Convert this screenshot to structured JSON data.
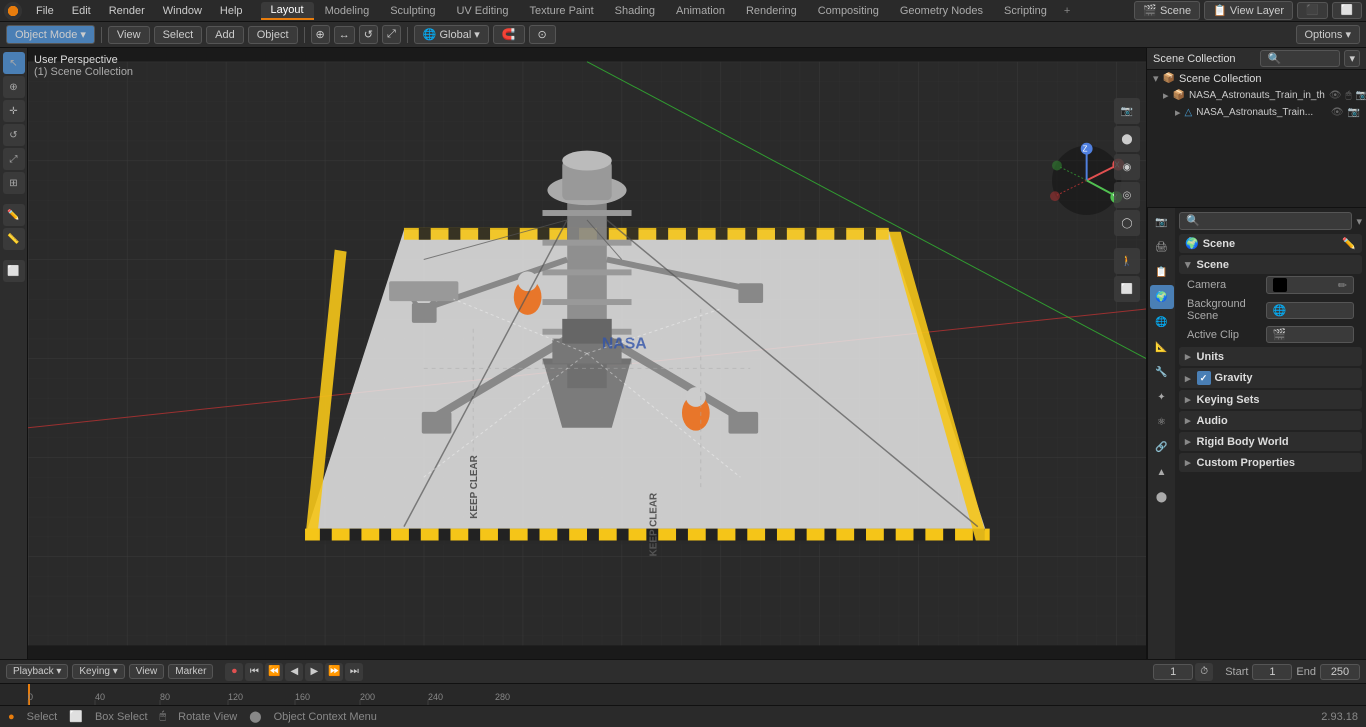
{
  "app": {
    "title": "Blender",
    "version": "2.93.18"
  },
  "top_menu": {
    "items": [
      "File",
      "Edit",
      "Render",
      "Window",
      "Help"
    ]
  },
  "workspace_tabs": {
    "tabs": [
      "Layout",
      "Modeling",
      "Sculpting",
      "UV Editing",
      "Texture Paint",
      "Shading",
      "Animation",
      "Rendering",
      "Compositing",
      "Geometry Nodes",
      "Scripting"
    ],
    "active": "Layout"
  },
  "second_bar": {
    "mode_label": "Object Mode",
    "view_label": "View",
    "select_label": "Select",
    "add_label": "Add",
    "object_label": "Object",
    "transform_label": "Global",
    "options_label": "Options ▾"
  },
  "viewport": {
    "info_line1": "User Perspective",
    "info_line2": "(1) Scene Collection"
  },
  "outliner": {
    "title": "Scene Collection",
    "items": [
      {
        "name": "NASA_Astronauts_Train_in_th",
        "type": "collection",
        "indent": 1,
        "expanded": true
      },
      {
        "name": "NASA_Astronauts_Train...",
        "type": "mesh",
        "indent": 2,
        "expanded": false
      }
    ]
  },
  "scene_name": "Scene",
  "view_layer_name": "View Layer",
  "properties": {
    "section_label": "Scene",
    "subsection_label": "Scene",
    "camera_label": "Camera",
    "camera_value": "",
    "background_scene_label": "Background Scene",
    "active_clip_label": "Active Clip",
    "units_label": "Units",
    "gravity_label": "Gravity",
    "gravity_checked": true,
    "keying_sets_label": "Keying Sets",
    "audio_label": "Audio",
    "rigid_body_world_label": "Rigid Body World",
    "custom_properties_label": "Custom Properties"
  },
  "timeline": {
    "playback_label": "Playback",
    "keying_label": "Keying",
    "view_label": "View",
    "marker_label": "Marker",
    "frame_current": "1",
    "start_label": "Start",
    "start_value": "1",
    "end_label": "End",
    "end_value": "250"
  },
  "ruler_marks": [
    "0",
    "40",
    "80",
    "120",
    "160",
    "200",
    "240"
  ],
  "ruler_ticks": [
    "0",
    "20",
    "40",
    "60",
    "80",
    "100",
    "120",
    "140",
    "160",
    "180",
    "200",
    "220",
    "240",
    "260",
    "280",
    "300"
  ],
  "status_bar": {
    "select_label": "Select",
    "select_icon": "●",
    "box_select_label": "Box Select",
    "rotate_view_label": "Rotate View",
    "object_context_label": "Object Context Menu",
    "version": "2.93.18"
  },
  "prop_side_icons": [
    "🔧",
    "📷",
    "🎬",
    "🌊",
    "⚙️",
    "🎭",
    "💡",
    "🌍",
    "🔩",
    "📐",
    "🎨"
  ],
  "colors": {
    "accent": "#e87d0d",
    "active_blue": "#4a7fb5",
    "bg_dark": "#1a1a1a",
    "bg_mid": "#2d2d2d",
    "bg_panel": "#222222"
  }
}
